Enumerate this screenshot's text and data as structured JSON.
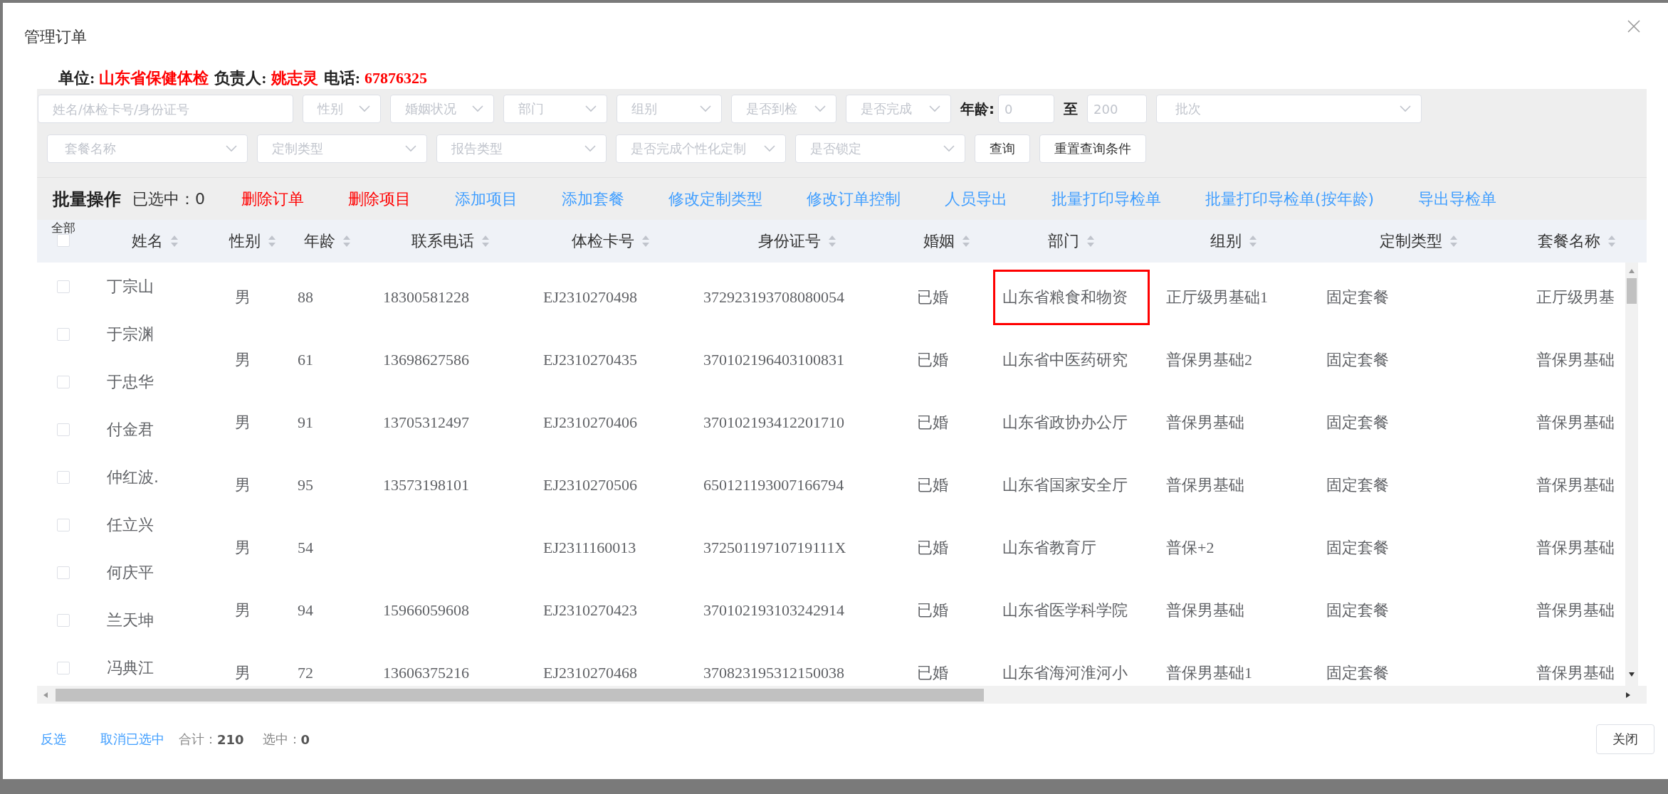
{
  "dialog": {
    "title": "管理订单"
  },
  "info": [
    {
      "label": "单位:",
      "value": "山东省保健体检"
    },
    {
      "label": "负责人:",
      "value": "姚志灵"
    },
    {
      "label": "电话:",
      "value": "67876325"
    }
  ],
  "filters": [
    [
      {
        "kind": "text",
        "placeholder": "姓名/体检卡号/身份证号"
      },
      {
        "kind": "select",
        "placeholder": "性别"
      },
      {
        "kind": "select",
        "placeholder": "婚姻状况"
      },
      {
        "kind": "select",
        "placeholder": "部门"
      },
      {
        "kind": "select",
        "placeholder": "组别"
      },
      {
        "kind": "select",
        "placeholder": "是否到检"
      },
      {
        "kind": "select",
        "placeholder": "是否完成"
      },
      {
        "kind": "label",
        "text": "年龄:"
      },
      {
        "kind": "text",
        "placeholder": "0"
      },
      {
        "kind": "label",
        "text": "至"
      },
      {
        "kind": "text",
        "placeholder": "200"
      },
      {
        "kind": "select",
        "placeholder": "批次"
      }
    ],
    [
      {
        "kind": "select",
        "placeholder": "套餐名称"
      },
      {
        "kind": "select",
        "placeholder": "定制类型"
      },
      {
        "kind": "select",
        "placeholder": "报告类型"
      },
      {
        "kind": "select",
        "placeholder": "是否完成个性化定制"
      },
      {
        "kind": "select",
        "placeholder": "是否锁定"
      },
      {
        "kind": "button",
        "text": "查询"
      },
      {
        "kind": "button",
        "text": "重置查询条件"
      }
    ]
  ],
  "batch": {
    "title": "批量操作",
    "selected_count": "已选中：0",
    "actions": [
      {
        "kind": "danger",
        "label": "删除订单"
      },
      {
        "kind": "danger",
        "label": "删除项目"
      },
      {
        "kind": "primary",
        "label": "添加项目"
      },
      {
        "kind": "primary",
        "label": "添加套餐"
      },
      {
        "kind": "primary",
        "label": "修改定制类型"
      },
      {
        "kind": "primary",
        "label": "修改订单控制"
      },
      {
        "kind": "primary",
        "label": "人员导出"
      },
      {
        "kind": "primary",
        "label": "批量打印导检单"
      },
      {
        "kind": "primary",
        "label": "批量打印导检单(按年龄)"
      },
      {
        "kind": "primary",
        "label": "导出导检单"
      }
    ]
  },
  "table": {
    "select_all": {
      "label": "全部",
      "checked": false
    },
    "columns": [
      "姓名",
      "性别",
      "年龄",
      "联系电话",
      "体检卡号",
      "身份证号",
      "婚姻",
      "部门",
      "组别",
      "定制类型",
      "套餐名称"
    ],
    "name_rows": [
      {
        "name": "丁宗山",
        "checked": false
      },
      {
        "name": "于宗渊",
        "checked": false
      },
      {
        "name": "于忠华",
        "checked": false
      },
      {
        "name": "付金君",
        "checked": false
      },
      {
        "name": "仲红波.",
        "checked": false
      },
      {
        "name": "任立兴",
        "checked": false
      },
      {
        "name": "何庆平",
        "checked": false
      },
      {
        "name": "兰天坤",
        "checked": false
      },
      {
        "name": "冯典江",
        "checked": false
      }
    ],
    "rows": [
      {
        "sex": "男",
        "age": "88",
        "phone": "18300581228",
        "card": "EJ2310270498",
        "id_number": "372923193708080054",
        "marriage": "已婚",
        "department": "山东省粮食和物资",
        "department_highlighted": true,
        "group": "正厅级男基础1",
        "custom_type": "固定套餐",
        "package": "正厅级男基"
      },
      {
        "sex": "男",
        "age": "61",
        "phone": "13698627586",
        "card": "EJ2310270435",
        "id_number": "370102196403100831",
        "marriage": "已婚",
        "department": "山东省中医药研究",
        "department_highlighted": false,
        "group": "普保男基础2",
        "custom_type": "固定套餐",
        "package": "普保男基础"
      },
      {
        "sex": "男",
        "age": "91",
        "phone": "13705312497",
        "card": "EJ2310270406",
        "id_number": "370102193412201710",
        "marriage": "已婚",
        "department": "山东省政协办公厅",
        "department_highlighted": false,
        "group": "普保男基础",
        "custom_type": "固定套餐",
        "package": "普保男基础"
      },
      {
        "sex": "男",
        "age": "95",
        "phone": "13573198101",
        "card": "EJ2310270506",
        "id_number": "650121193007166794",
        "marriage": "已婚",
        "department": "山东省国家安全厅",
        "department_highlighted": false,
        "group": "普保男基础",
        "custom_type": "固定套餐",
        "package": "普保男基础"
      },
      {
        "sex": "男",
        "age": "54",
        "card": "EJ2311160013",
        "id_number": "37250119710719111X",
        "marriage": "已婚",
        "department": "山东省教育厅",
        "department_highlighted": false,
        "group": "普保+2",
        "custom_type": "固定套餐",
        "package": "普保男基础"
      },
      {
        "sex": "男",
        "age": "94",
        "phone": "15966059608",
        "card": "EJ2310270423",
        "id_number": "370102193103242914",
        "marriage": "已婚",
        "department": "山东省医学科学院",
        "department_highlighted": false,
        "group": "普保男基础",
        "custom_type": "固定套餐",
        "package": "普保男基础"
      },
      {
        "sex": "男",
        "age": "72",
        "phone": "13606375216",
        "card": "EJ2310270468",
        "id_number": "370823195312150038",
        "marriage": "已婚",
        "department": "山东省海河淮河小",
        "department_highlighted": false,
        "group": "普保男基础1",
        "custom_type": "固定套餐",
        "package": "普保男基础"
      }
    ]
  },
  "footer": {
    "links": [
      "反选",
      "取消已选中"
    ],
    "stats": [
      {
        "label": "合计：",
        "value": "210"
      },
      {
        "label": "选中：",
        "value": "0"
      }
    ],
    "close": "关闭"
  }
}
